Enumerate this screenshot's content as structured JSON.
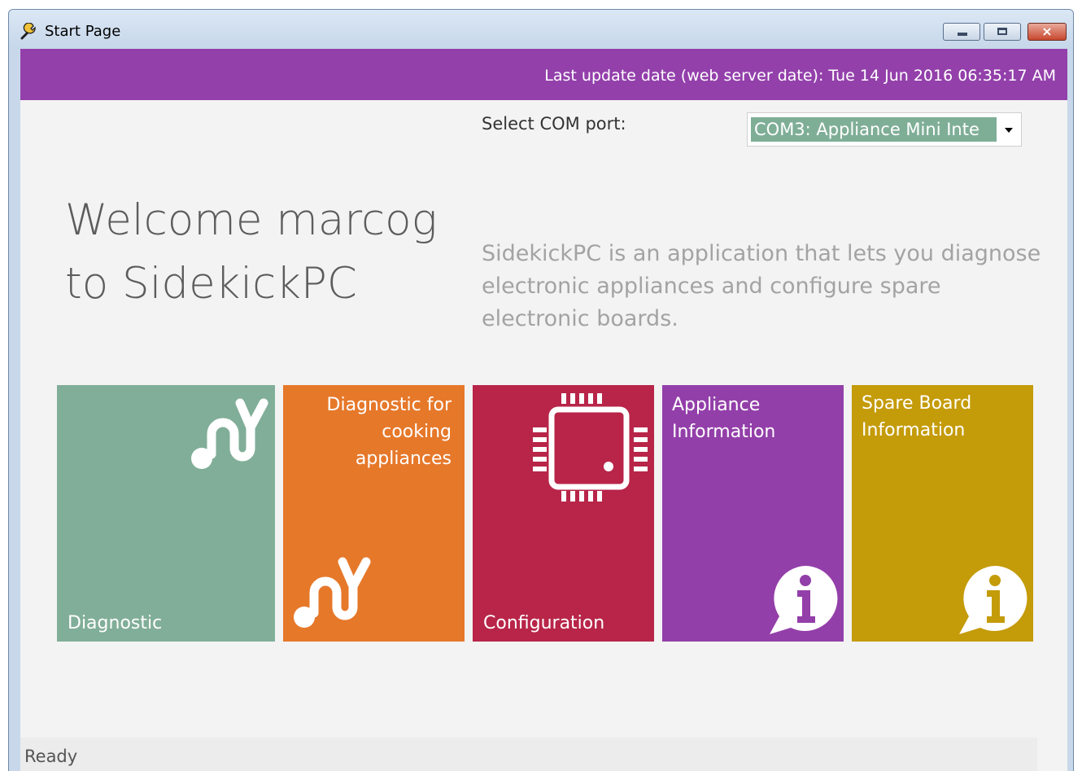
{
  "window": {
    "title": "Start Page",
    "controls": {
      "minimize": "minimize",
      "maximize": "maximize",
      "close": "×"
    }
  },
  "header": {
    "update_text": "Last update date (web server date):  Tue 14 Jun 2016 06:35:17 AM"
  },
  "com_port": {
    "label": "Select COM port:",
    "selected": "COM3: Appliance Mini Inte"
  },
  "welcome": {
    "line1": "Welcome marcog",
    "line2": "to SidekickPC"
  },
  "description": "SidekickPC is an application that lets you diagnose electronic appliances and configure spare electronic boards.",
  "tiles": [
    {
      "label": "Diagnostic",
      "icon": "stethoscope-icon",
      "color": "#81ae98"
    },
    {
      "label": "Diagnostic for cooking appliances",
      "icon": "stethoscope-icon",
      "color": "#e6782a"
    },
    {
      "label": "Configuration",
      "icon": "chip-icon",
      "color": "#b82549"
    },
    {
      "label": "Appliance Information",
      "icon": "info-bubble-icon",
      "color": "#933fa9"
    },
    {
      "label": "Spare Board Information",
      "icon": "info-bubble-icon",
      "color": "#c49b09"
    }
  ],
  "status": {
    "text": "Ready"
  }
}
